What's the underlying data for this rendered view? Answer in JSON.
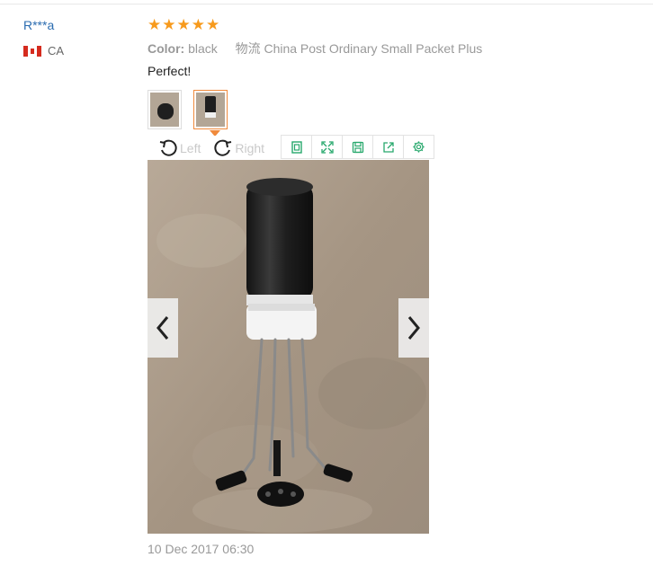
{
  "reviewer": {
    "name": "R***a",
    "country": "CA"
  },
  "rating": {
    "stars": 5,
    "max": 5
  },
  "order": {
    "color_key": "Color:",
    "color_value": "black",
    "shipping": "物流 China Post Ordinary Small Packet Plus"
  },
  "comment": "Perfect!",
  "viewer": {
    "rotate_left": "Left",
    "rotate_right": "Right",
    "selected_thumbnail": 2,
    "thumbnail_count": 2
  },
  "date": "10 Dec 2017 06:30",
  "colors": {
    "accent": "#f79a1c",
    "link": "#2b6cb0",
    "toolbar_icon": "#27a86c"
  }
}
